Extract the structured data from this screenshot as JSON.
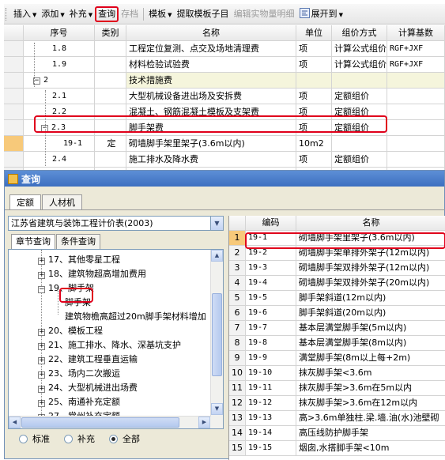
{
  "toolbar": {
    "insert": "插入",
    "add": "添加",
    "supplement": "补充",
    "query": "查询",
    "save_price": "存档",
    "template": "模板",
    "extract_template": "提取模板子目",
    "edit_quantity": "编辑实物量明细",
    "expand_to": "展开到"
  },
  "grid": {
    "headers": [
      "序号",
      "类别",
      "名称",
      "单位",
      "组价方式",
      "计算基数"
    ],
    "rows": [
      {
        "seq": "1.8",
        "cat": "",
        "name": "工程定位复测、点交及场地清理费",
        "unit": "项",
        "method": "计算公式组价",
        "base": "RGF+JXF"
      },
      {
        "seq": "1.9",
        "cat": "",
        "name": "材料检验试验费",
        "unit": "项",
        "method": "计算公式组价",
        "base": "RGF+JXF"
      },
      {
        "seq": "2",
        "cat": "",
        "name": "技术措施费",
        "unit": "",
        "method": "",
        "base": ""
      },
      {
        "seq": "2.1",
        "cat": "",
        "name": "大型机械设备进出场及安拆费",
        "unit": "项",
        "method": "定额组价",
        "base": ""
      },
      {
        "seq": "2.2",
        "cat": "",
        "name": "混凝土、钢筋混凝土模板及支架费",
        "unit": "项",
        "method": "定额组价",
        "base": ""
      },
      {
        "seq": "2.3",
        "cat": "",
        "name": "脚手架费",
        "unit": "项",
        "method": "定额组价",
        "base": ""
      },
      {
        "seq": "19-1",
        "cat": "定",
        "name": "砌墙脚手架里架子(3.6m以内)",
        "unit": "10m2",
        "method": "",
        "base": ""
      },
      {
        "seq": "2.4",
        "cat": "",
        "name": "施工排水及降水费",
        "unit": "项",
        "method": "定额组价",
        "base": ""
      }
    ]
  },
  "dialog": {
    "title": "查询",
    "tabs": [
      "定额",
      "人材机"
    ],
    "library": "江苏省建筑与装饰工程计价表(2003)",
    "subtabs": [
      "章节查询",
      "条件查询"
    ],
    "tree": [
      {
        "label": "17、其他零星工程",
        "pm": "+"
      },
      {
        "label": "18、建筑物超高增加费用",
        "pm": "+"
      },
      {
        "label": "19、脚手架",
        "pm": "−"
      },
      {
        "label": "脚手架",
        "pm": ""
      },
      {
        "label": "建筑物檐高超过20m脚手架材料增加",
        "pm": ""
      },
      {
        "label": "20、模板工程",
        "pm": "+"
      },
      {
        "label": "21、施工排水、降水、深基坑支护",
        "pm": "+"
      },
      {
        "label": "22、建筑工程垂直运输",
        "pm": "+"
      },
      {
        "label": "23、场内二次搬运",
        "pm": "+"
      },
      {
        "label": "24、大型机械进出场费",
        "pm": "+"
      },
      {
        "label": "25、南通补充定额",
        "pm": "+"
      },
      {
        "label": "27、常州补充定额",
        "pm": "+"
      }
    ],
    "radios": [
      "标准",
      "补充",
      "全部"
    ],
    "table": {
      "headers": [
        "编码",
        "名称"
      ],
      "rows": [
        {
          "no": "1",
          "code": "19-1",
          "name": "砌墙脚手架里架子(3.6m以内)"
        },
        {
          "no": "2",
          "code": "19-2",
          "name": "砌墙脚手架单排外架子(12m以内)"
        },
        {
          "no": "3",
          "code": "19-3",
          "name": "砌墙脚手架双排外架子(12m以内)"
        },
        {
          "no": "4",
          "code": "19-4",
          "name": "砌墙脚手架双排外架子(20m以内)"
        },
        {
          "no": "5",
          "code": "19-5",
          "name": "脚手架斜道(12m以内)"
        },
        {
          "no": "6",
          "code": "19-6",
          "name": "脚手架斜道(20m以内)"
        },
        {
          "no": "7",
          "code": "19-7",
          "name": "基本层满堂脚手架(5m以内)"
        },
        {
          "no": "8",
          "code": "19-8",
          "name": "基本层满堂脚手架(8m以内)"
        },
        {
          "no": "9",
          "code": "19-9",
          "name": "满堂脚手架(8m以上每+2m)"
        },
        {
          "no": "10",
          "code": "19-10",
          "name": "抹灰脚手架<3.6m"
        },
        {
          "no": "11",
          "code": "19-11",
          "name": "抹灰脚手架>3.6m在5m以内"
        },
        {
          "no": "12",
          "code": "19-12",
          "name": "抹灰脚手架>3.6m在12m以内"
        },
        {
          "no": "13",
          "code": "19-13",
          "name": "高>3.6m单独柱.梁.墙.油(水)池壁砌"
        },
        {
          "no": "14",
          "code": "19-14",
          "name": "高压线防护脚手架"
        },
        {
          "no": "15",
          "code": "19-15",
          "name": "烟囱,水搭脚手架<10m"
        }
      ]
    }
  }
}
